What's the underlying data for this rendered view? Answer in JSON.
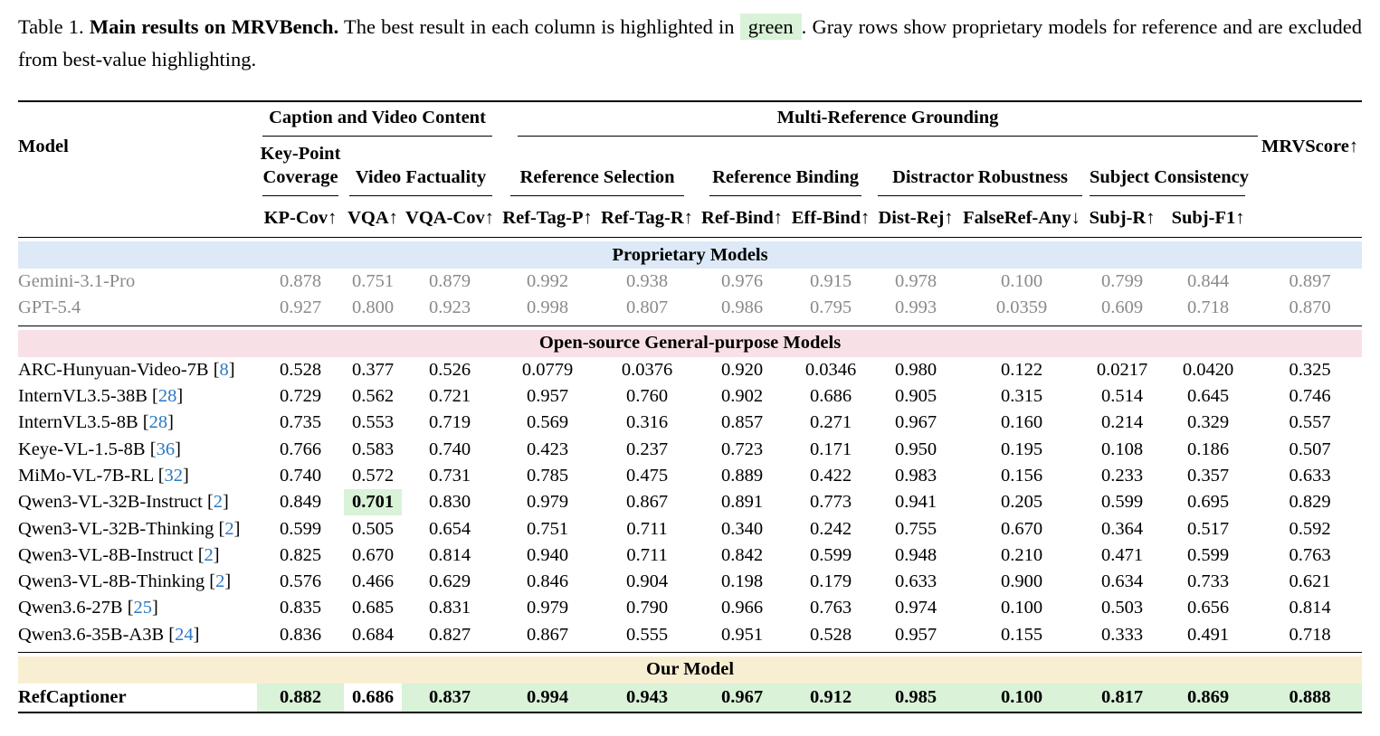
{
  "caption": {
    "label": "Table 1.",
    "title": "Main results on MRVBench.",
    "text_before": "The best result in each column is highlighted in",
    "highlight_word": "green",
    "text_after": ". Gray rows show proprietary models for reference and are excluded from best-value highlighting."
  },
  "header": {
    "model": "Model",
    "group1": "Caption and Video Content",
    "group2": "Multi-Reference Grounding",
    "mrvscore": "MRVScore↑",
    "sub_kp_line1": "Key-Point",
    "sub_kp_line2": "Coverage",
    "sub_vf": "Video Factuality",
    "sub_rs": "Reference Selection",
    "sub_rb": "Reference Binding",
    "sub_dr": "Distractor Robustness",
    "sub_sc": "Subject Consistency",
    "metrics": [
      "KP-Cov↑",
      "VQA↑",
      "VQA-Cov↑",
      "Ref-Tag-P↑",
      "Ref-Tag-R↑",
      "Ref-Bind↑",
      "Eff-Bind↑",
      "Dist-Rej↑",
      "FalseRef-Any↓",
      "Subj-R↑",
      "Subj-F1↑"
    ]
  },
  "sections": {
    "proprietary": "Proprietary Models",
    "open_source": "Open-source General-purpose Models",
    "ours": "Our Model"
  },
  "proprietary_rows": [
    {
      "name": "Gemini-3.1-Pro",
      "ref": "",
      "values": [
        "0.878",
        "0.751",
        "0.879",
        "0.992",
        "0.938",
        "0.976",
        "0.915",
        "0.978",
        "0.100",
        "0.799",
        "0.844",
        "0.897"
      ]
    },
    {
      "name": "GPT-5.4",
      "ref": "",
      "values": [
        "0.927",
        "0.800",
        "0.923",
        "0.998",
        "0.807",
        "0.986",
        "0.795",
        "0.993",
        "0.0359",
        "0.609",
        "0.718",
        "0.870"
      ]
    }
  ],
  "open_rows": [
    {
      "name": "ARC-Hunyuan-Video-7B",
      "ref": "8",
      "values": [
        "0.528",
        "0.377",
        "0.526",
        "0.0779",
        "0.0376",
        "0.920",
        "0.0346",
        "0.980",
        "0.122",
        "0.0217",
        "0.0420",
        "0.325"
      ]
    },
    {
      "name": "InternVL3.5-38B",
      "ref": "28",
      "values": [
        "0.729",
        "0.562",
        "0.721",
        "0.957",
        "0.760",
        "0.902",
        "0.686",
        "0.905",
        "0.315",
        "0.514",
        "0.645",
        "0.746"
      ]
    },
    {
      "name": "InternVL3.5-8B",
      "ref": "28",
      "values": [
        "0.735",
        "0.553",
        "0.719",
        "0.569",
        "0.316",
        "0.857",
        "0.271",
        "0.967",
        "0.160",
        "0.214",
        "0.329",
        "0.557"
      ]
    },
    {
      "name": "Keye-VL-1.5-8B",
      "ref": "36",
      "values": [
        "0.766",
        "0.583",
        "0.740",
        "0.423",
        "0.237",
        "0.723",
        "0.171",
        "0.950",
        "0.195",
        "0.108",
        "0.186",
        "0.507"
      ]
    },
    {
      "name": "MiMo-VL-7B-RL",
      "ref": "32",
      "values": [
        "0.740",
        "0.572",
        "0.731",
        "0.785",
        "0.475",
        "0.889",
        "0.422",
        "0.983",
        "0.156",
        "0.233",
        "0.357",
        "0.633"
      ]
    },
    {
      "name": "Qwen3-VL-32B-Instruct",
      "ref": "2",
      "values": [
        "0.849",
        "0.701",
        "0.830",
        "0.979",
        "0.867",
        "0.891",
        "0.773",
        "0.941",
        "0.205",
        "0.599",
        "0.695",
        "0.829"
      ],
      "best": [
        1
      ]
    },
    {
      "name": "Qwen3-VL-32B-Thinking",
      "ref": "2",
      "values": [
        "0.599",
        "0.505",
        "0.654",
        "0.751",
        "0.711",
        "0.340",
        "0.242",
        "0.755",
        "0.670",
        "0.364",
        "0.517",
        "0.592"
      ]
    },
    {
      "name": "Qwen3-VL-8B-Instruct",
      "ref": "2",
      "values": [
        "0.825",
        "0.670",
        "0.814",
        "0.940",
        "0.711",
        "0.842",
        "0.599",
        "0.948",
        "0.210",
        "0.471",
        "0.599",
        "0.763"
      ]
    },
    {
      "name": "Qwen3-VL-8B-Thinking",
      "ref": "2",
      "values": [
        "0.576",
        "0.466",
        "0.629",
        "0.846",
        "0.904",
        "0.198",
        "0.179",
        "0.633",
        "0.900",
        "0.634",
        "0.733",
        "0.621"
      ]
    },
    {
      "name": "Qwen3.6-27B",
      "ref": "25",
      "values": [
        "0.835",
        "0.685",
        "0.831",
        "0.979",
        "0.790",
        "0.966",
        "0.763",
        "0.974",
        "0.100",
        "0.503",
        "0.656",
        "0.814"
      ]
    },
    {
      "name": "Qwen3.6-35B-A3B",
      "ref": "24",
      "values": [
        "0.836",
        "0.684",
        "0.827",
        "0.867",
        "0.555",
        "0.951",
        "0.528",
        "0.957",
        "0.155",
        "0.333",
        "0.491",
        "0.718"
      ]
    }
  ],
  "our_row": {
    "name": "RefCaptioner",
    "values": [
      "0.882",
      "0.686",
      "0.837",
      "0.994",
      "0.943",
      "0.967",
      "0.912",
      "0.985",
      "0.100",
      "0.817",
      "0.869",
      "0.888"
    ],
    "best": [
      0,
      2,
      3,
      4,
      5,
      6,
      7,
      8,
      9,
      10,
      11
    ]
  },
  "colors": {
    "best_highlight": "#d9f2d8",
    "proprietary_band": "#dde9f6",
    "open_band": "#f8e1e6",
    "ours_band": "#f8efd2",
    "gray_text": "#8a8a8a",
    "citation": "#2a78c4"
  }
}
